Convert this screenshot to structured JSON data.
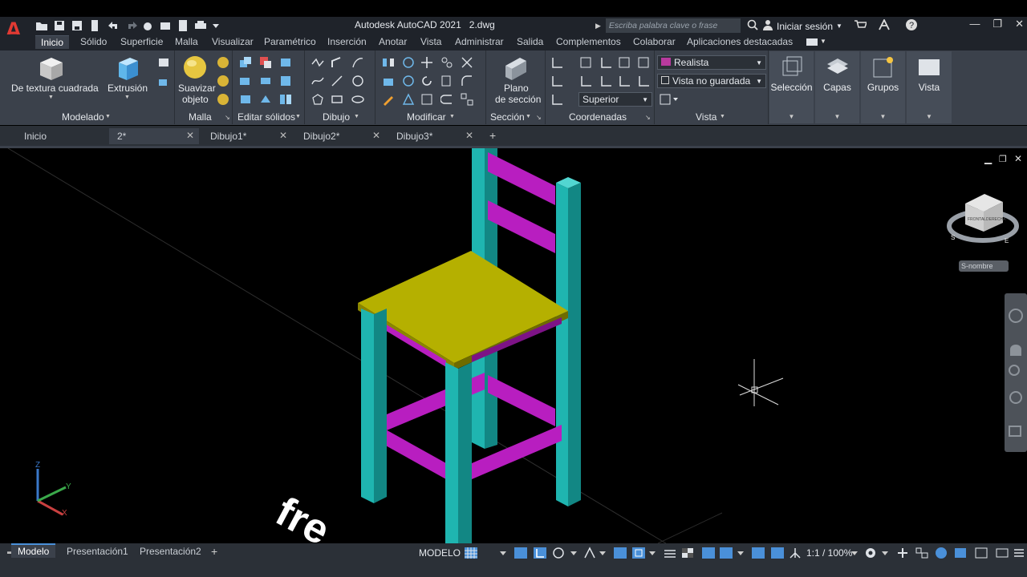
{
  "app": {
    "title": "Autodesk AutoCAD 2021",
    "file": "2.dwg",
    "logo": "A",
    "search_placeholder": "Escriba palabra clave o frase",
    "signin": "Iniciar sesión"
  },
  "ribbon_tabs": [
    "Inicio",
    "Sólido",
    "Superficie",
    "Malla",
    "Visualizar",
    "Paramétrico",
    "Inserción",
    "Anotar",
    "Vista",
    "Administrar",
    "Salida",
    "Complementos",
    "Colaborar",
    "Aplicaciones destacadas"
  ],
  "panels": {
    "modelado": {
      "title": "Modelado",
      "btn1": "De textura cuadrada",
      "btn2": "Extrusión"
    },
    "malla": {
      "title": "Malla",
      "btn1a": "Suavizar",
      "btn1b": "objeto"
    },
    "editar": {
      "title": "Editar sólidos"
    },
    "dibujo": {
      "title": "Dibujo"
    },
    "modificar": {
      "title": "Modificar"
    },
    "seccion": {
      "title": "Sección",
      "btn1a": "Plano",
      "btn1b": "de sección"
    },
    "coordenadas": {
      "title": "Coordenadas",
      "ucs_combo": "Superior"
    },
    "vista": {
      "title": "Vista",
      "visual_style": "Realista",
      "saved_view": "Vista no guardada"
    },
    "seleccion": "Selección",
    "capas": "Capas",
    "grupos": "Grupos",
    "vista_big": "Vista"
  },
  "doc_tabs": [
    {
      "label": "Inicio"
    },
    {
      "label": "2*"
    },
    {
      "label": "Dibujo1*"
    },
    {
      "label": "Dibujo2*"
    },
    {
      "label": "Dibujo3*"
    }
  ],
  "viewcube": {
    "face_front": "FRONTAL",
    "face_right": "DERECHA",
    "ucs_label": "S-nombre",
    "compass_s": "S",
    "compass_e": "E"
  },
  "ucs_icon": {
    "x": "X",
    "y": "Y",
    "z": "Z"
  },
  "watermark": "fre",
  "layout_tabs": [
    "Modelo",
    "Presentación1",
    "Presentación2"
  ],
  "status": {
    "space": "MODELO",
    "scale": "1:1 / 100%"
  },
  "colors": {
    "leg": "#1fb5b0",
    "leg_dark": "#128784",
    "rail": "#b81ec0",
    "rail_dark": "#7d1386",
    "seat_top": "#b5b000",
    "seat_edge": "#8a8600",
    "ribbon_bg": "#3b414b",
    "accent": "#4a90d9"
  }
}
